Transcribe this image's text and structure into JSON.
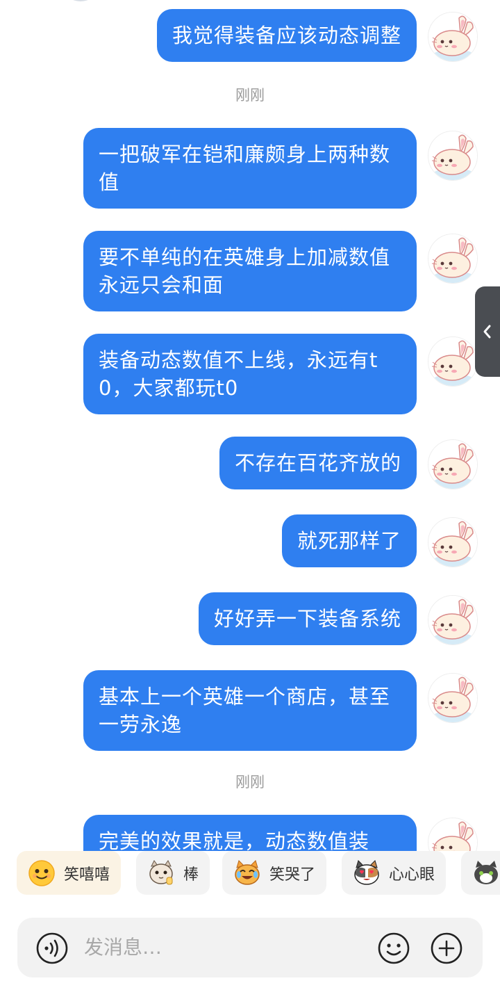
{
  "messages": [
    {
      "text": "我觉得装备应该动态调整"
    },
    {
      "text": "一把破军在铠和廉颇身上两种数值"
    },
    {
      "text": "要不单纯的在英雄身上加减数值永远只会和面"
    },
    {
      "text": "装备动态数值不上线，永远有t0，大家都玩t0"
    },
    {
      "text": "不存在百花齐放的"
    },
    {
      "text": "就死那样了"
    },
    {
      "text": "好好弄一下装备系统"
    },
    {
      "text": "基本上一个英雄一个商店，甚至一劳永逸"
    },
    {
      "text": "完美的效果就是，动态数值装"
    }
  ],
  "timestamps": [
    {
      "text": "刚刚"
    },
    {
      "text": "刚刚"
    }
  ],
  "avatar": {
    "icon": "bunny-avatar-icon"
  },
  "side_handle": {
    "icon": "chevron-left-icon"
  },
  "reactions": [
    {
      "label": "笑嘻嘻",
      "icon": "grin-emoji-icon"
    },
    {
      "label": "棒",
      "icon": "cat-thumbs-up-icon"
    },
    {
      "label": "笑哭了",
      "icon": "crying-laughing-cat-icon"
    },
    {
      "label": "心心眼",
      "icon": "heart-eyes-cat-icon"
    },
    {
      "label": "",
      "icon": "cat-emoji-icon"
    }
  ],
  "input": {
    "placeholder": "发消息…",
    "voice_icon": "voice-icon",
    "emoji_icon": "emoji-icon",
    "plus_icon": "plus-icon"
  },
  "colors": {
    "bubble": "#2f7ff0",
    "bubble_text": "#ffffff",
    "timestamp": "#9a9a9a",
    "input_bg": "#f2f2f2",
    "side_handle": "#4a4d52"
  }
}
